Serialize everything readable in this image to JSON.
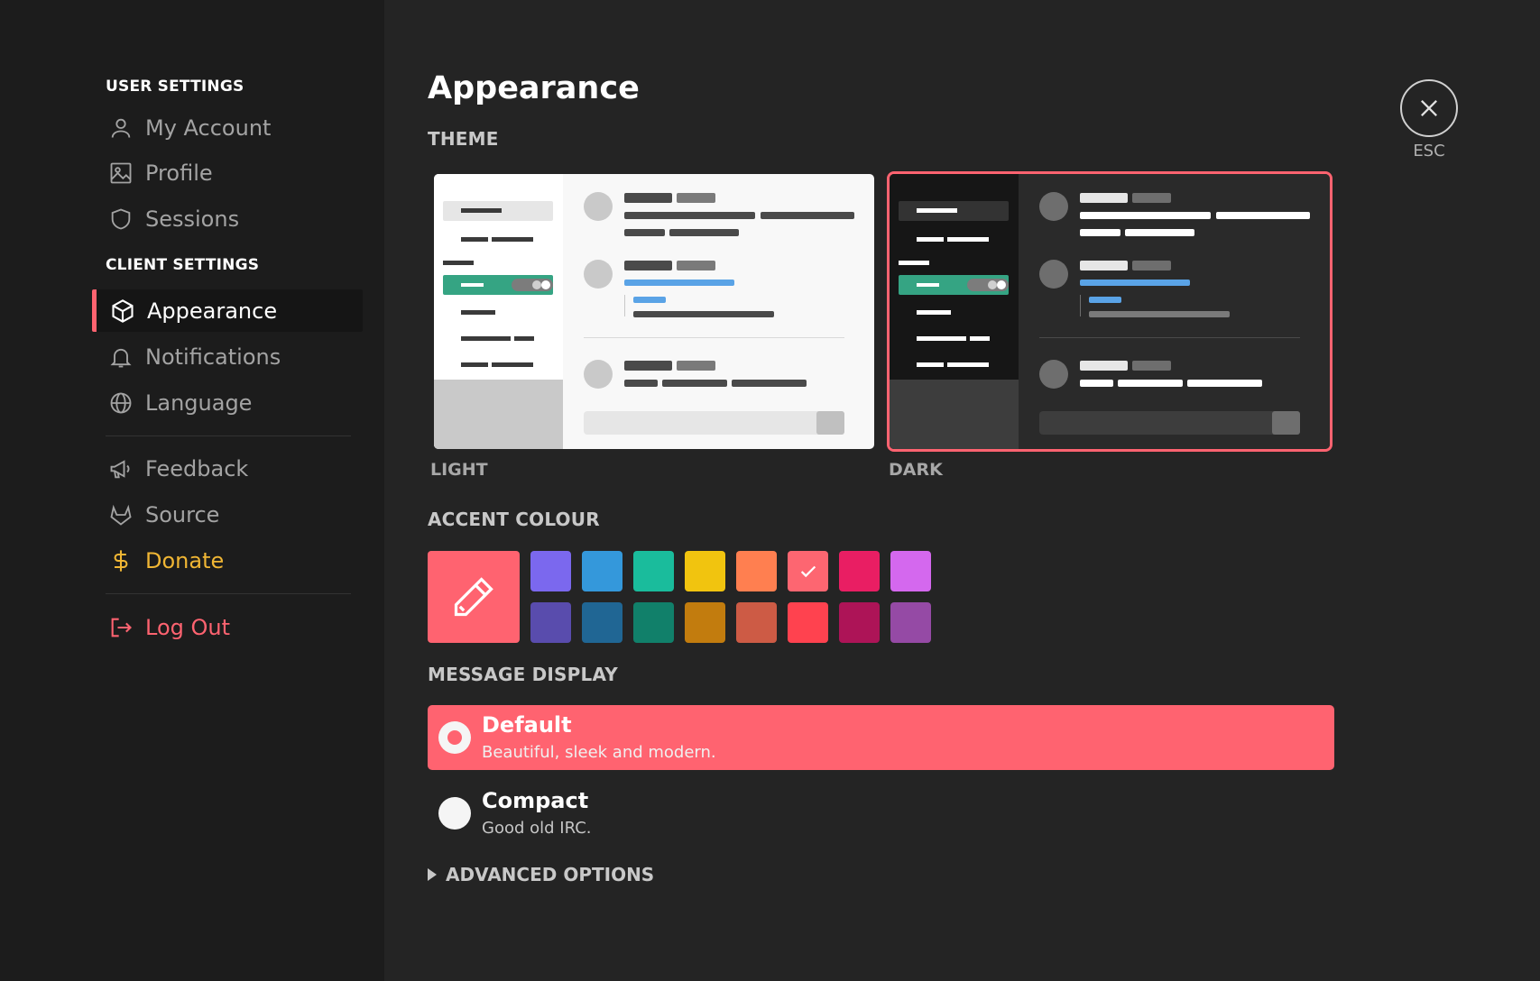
{
  "sidebar": {
    "user_settings_title": "USER SETTINGS",
    "client_settings_title": "CLIENT SETTINGS",
    "items": {
      "my_account": "My Account",
      "profile": "Profile",
      "sessions": "Sessions",
      "appearance": "Appearance",
      "notifications": "Notifications",
      "language": "Language",
      "feedback": "Feedback",
      "source": "Source",
      "donate": "Donate",
      "log_out": "Log Out"
    }
  },
  "main": {
    "title": "Appearance",
    "close_label": "ESC",
    "theme": {
      "heading": "THEME",
      "light_label": "LIGHT",
      "dark_label": "DARK",
      "selected": "dark"
    },
    "accent": {
      "heading": "ACCENT COLOUR",
      "selected": "#ff6370",
      "custom_icon": "pencil-icon",
      "top_row": [
        "#7b68ee",
        "#3498db",
        "#1abc9c",
        "#f1c40f",
        "#ff7f50",
        "#fd6671",
        "#e91e63",
        "#d468ee"
      ],
      "bottom_row": [
        "#594cad",
        "#206694",
        "#11806a",
        "#c27c0e",
        "#cd5b45",
        "#ff424f",
        "#ad1457",
        "#954aa5"
      ]
    },
    "message_display": {
      "heading": "MESSAGE DISPLAY",
      "options": [
        {
          "title": "Default",
          "description": "Beautiful, sleek and modern.",
          "selected": true
        },
        {
          "title": "Compact",
          "description": "Good old IRC.",
          "selected": false
        }
      ]
    },
    "advanced_label": "ADVANCED OPTIONS"
  },
  "colors": {
    "accent": "#ff6370",
    "donate": "#f0b634",
    "sidebar_bg": "#1c1c1c",
    "main_bg": "#242424"
  }
}
